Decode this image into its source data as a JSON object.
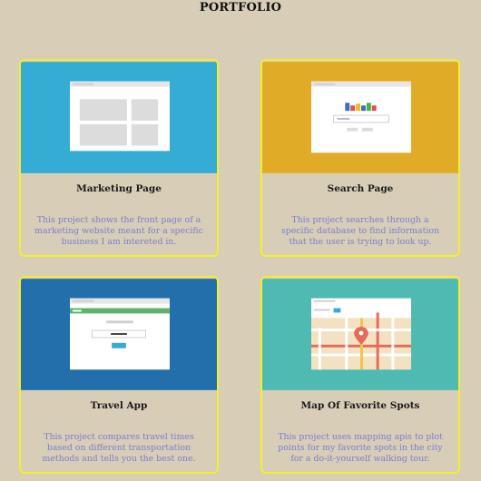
{
  "page": {
    "title": "PORTFOLIO"
  },
  "projects": [
    {
      "name": "Marketing Page",
      "description": "This project shows the front page of a marketing website meant for a specific business I am intereted in.",
      "thumb_color": "#35acd3"
    },
    {
      "name": "Search Page",
      "description": "This project searches through a specific database to find information that the user is trying to look up.",
      "thumb_color": "#e0ac28"
    },
    {
      "name": "Travel App",
      "description": "This project compares travel times based on different transportation methods and tells you the best one.",
      "thumb_color": "#236fab"
    },
    {
      "name": "Map Of Favorite Spots",
      "description": "This project uses mapping apis to plot points for my favorite spots in the city for a do-it-yourself walking tour.",
      "thumb_color": "#4fbab1"
    }
  ],
  "colors": {
    "background": "#d8cdb7",
    "card_border": "#f3ef2c",
    "description_text": "#7b80cf"
  }
}
